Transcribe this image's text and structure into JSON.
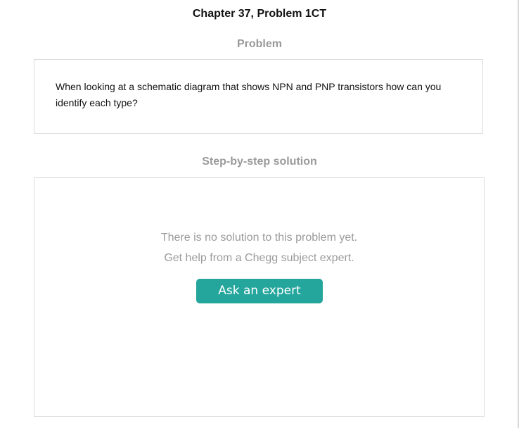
{
  "header": {
    "chapter_title": "Chapter 37, Problem 1CT"
  },
  "problem": {
    "heading": "Problem",
    "text": "When looking at a schematic diagram that shows NPN and PNP transistors how can you identify each type?"
  },
  "solution": {
    "heading": "Step-by-step solution",
    "no_solution_text": "There is no solution to this problem yet.",
    "help_text": "Get help from a Chegg subject expert.",
    "ask_button_label": "Ask an expert"
  },
  "colors": {
    "accent": "#25a69d",
    "muted_text": "#9b9b9b",
    "border": "#dcdcdc"
  }
}
